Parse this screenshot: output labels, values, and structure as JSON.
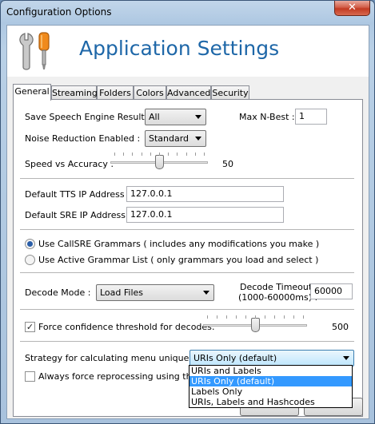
{
  "window": {
    "title": "Configuration Options",
    "close_glyph": "✕"
  },
  "header": {
    "app_title": "Application Settings",
    "icon": "tools-icon"
  },
  "tabs": [
    {
      "label": "General",
      "active": true
    },
    {
      "label": "Streaming",
      "active": false
    },
    {
      "label": "Folders",
      "active": false
    },
    {
      "label": "Colors",
      "active": false
    },
    {
      "label": "Advanced",
      "active": false
    },
    {
      "label": "Security",
      "active": false
    }
  ],
  "general": {
    "save_results_label": "Save Speech Engine Results :",
    "save_results_value": "All",
    "max_nbest_label": "Max N-Best :",
    "max_nbest_value": "1",
    "noise_label": "Noise Reduction Enabled :",
    "noise_value": "Standard",
    "speed_label": "Speed vs Accuracy :",
    "speed_value": "50",
    "speed_fraction": 0.5,
    "tts_label": "Default TTS IP Address :",
    "tts_value": "127.0.0.1",
    "sre_label": "Default SRE IP Address",
    "sre_value": "127.0.0.1",
    "radio_callsre": "Use CallSRE Grammars ( includes any modifications you make )",
    "radio_active": "Use Active Grammar List ( only grammars you load and select )",
    "decode_mode_label": "Decode Mode :",
    "decode_mode_value": "Load Files",
    "decode_timeout_label_1": "Decode Timeout",
    "decode_timeout_label_2": "(1000-60000ms) :",
    "decode_timeout_value": "60000",
    "force_confidence_label": "Force confidence threshold for decodes:",
    "force_confidence_checked": true,
    "threshold_value": "500",
    "threshold_fraction": 0.5,
    "strategy_label": "Strategy for calculating menu uniqueness:",
    "strategy_value": "URIs Only (default)",
    "strategy_options": [
      {
        "label": "URIs and Labels",
        "selected": false
      },
      {
        "label": "URIs Only (default)",
        "selected": true
      },
      {
        "label": "Labels Only",
        "selected": false
      },
      {
        "label": "URIs, Labels and Hashcodes",
        "selected": false
      }
    ],
    "reprocess_label": "Always force reprocessing using this sele",
    "reprocess_checked": false
  }
}
